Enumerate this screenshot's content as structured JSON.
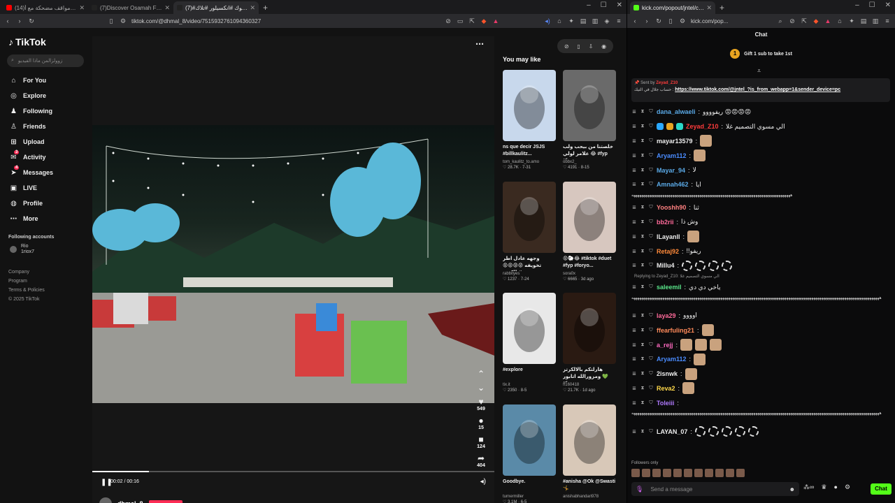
{
  "left_browser": {
    "tabs": [
      {
        "title": "(14)اليش أنا حولا؟ مواقف مضحكة مع أ",
        "fav_color": "#ff0000"
      },
      {
        "title": "(7)Discover Osamah Fayez: Best Mo",
        "fav_color": "#222222"
      },
      {
        "title": "(7)#تيك_توك #انكسيلور #تلاك...",
        "fav_color": "#222222"
      }
    ],
    "url": "tiktok.com/@dhmal_8/video/7515932761094360327"
  },
  "right_browser": {
    "tabs": [
      {
        "title": "kick.com/popout/jntel/chat",
        "fav_color": "#53fc18"
      }
    ],
    "url": "kick.com/pop..."
  },
  "tiktok": {
    "logo": "TikTok",
    "search_placeholder": "زوولزالمن ماذا الفيديو",
    "nav": [
      {
        "label": "For You",
        "icon": "home-icon"
      },
      {
        "label": "Explore",
        "icon": "compass-icon"
      },
      {
        "label": "Following",
        "icon": "following-icon"
      },
      {
        "label": "Friends",
        "icon": "friends-icon"
      },
      {
        "label": "Upload",
        "icon": "upload-icon"
      },
      {
        "label": "Activity",
        "icon": "activity-icon",
        "badge": "3"
      },
      {
        "label": "Messages",
        "icon": "messages-icon",
        "badge": "4"
      },
      {
        "label": "LIVE",
        "icon": "live-icon"
      },
      {
        "label": "Profile",
        "icon": "profile-icon"
      },
      {
        "label": "More",
        "icon": "more-icon"
      }
    ],
    "following_accounts_label": "Following accounts",
    "account": {
      "name": "Rio",
      "handle": "1riox7"
    },
    "footer": [
      "Company",
      "Program",
      "Terms & Policies",
      "© 2025 TikTok"
    ],
    "actions": {
      "likes": "549",
      "comments": "15",
      "saves": "124",
      "shares": "404"
    },
    "time": "00:02 / 00:16",
    "progress": 0.14,
    "author": "dhmal_8",
    "you_may_like": "You may like",
    "cards": [
      {
        "title": "ns que decir JSJS #billkaulitz...",
        "author": "tom_kaulitz_to.amo",
        "stats": "♡ 28.7K · 7-31",
        "bg": "#c8d8ec"
      },
      {
        "title": "خلصتنا من بيحب ولب علامر لولي 😂 #fyp #foryo...",
        "author": "obbx2_",
        "stats": "♡ 4191 · 8-15",
        "bg": "#6a6a6a"
      },
      {
        "title": "وجهه عادل اطر تخويفه 😡😡😡😡 #تالكرنز",
        "author": "rabbityes",
        "stats": "♡ 1237 · 7-24",
        "bg": "#3a2a20"
      },
      {
        "title": "😡🐑😂 #tiktok #duet #fyp #foryo...",
        "author": "sora0x",
        "stats": "♡ 6665 · 3d ago",
        "bg": "#d7c7bf"
      },
      {
        "title": "#explore",
        "author": "tix.it",
        "stats": "♡ 2350 · 8-5",
        "bg": "#e8e8e8"
      },
      {
        "title": "هارلتكم بالالكرتز ومزورالله اتابور 💚 #fyp...",
        "author": "ff160418",
        "stats": "♡ 21.7K · 1d ago",
        "bg": "#2a1a12"
      },
      {
        "title": "Goodbye.",
        "author": "turnermiller",
        "stats": "♡ 3.1M · 6-5",
        "bg": "#5a8aa8"
      },
      {
        "title": "#anisha @Ok @Swasti 🤸",
        "author": "anishabhandari978",
        "stats": "",
        "bg": "#d8c8b8"
      }
    ]
  },
  "kick": {
    "header": "Chat",
    "gift_count": "1",
    "gift_text": "Gift 1 sub to take 1st",
    "pinned": {
      "sent_by_label": "Sent by",
      "sender": "Zeyad_Z10",
      "text": "حساب جلال في التيك :",
      "link": "https://www.tiktok.com/@jntel_?is_from_webapp=1&sender_device=pc"
    },
    "messages": [
      {
        "user": "dana_alwaeli",
        "color": "#5aa9e6",
        "text": "ريفوووو 😡😡😡😡"
      },
      {
        "user": "Zeyad_Z10",
        "color": "#ff3b3b",
        "text": "الي مسوي التصميم غلا",
        "badges": true
      },
      {
        "user": "mayar13579",
        "color": "#eeeeee",
        "text": "",
        "emotes": 1
      },
      {
        "user": "Aryam112",
        "color": "#4a8cff",
        "text": "",
        "emotes": 1
      },
      {
        "user": "Mayar_94",
        "color": "#5aa9e6",
        "text": "لا"
      },
      {
        "user": "Amnah462",
        "color": "#5aa9e6",
        "text": "ايا"
      },
      {
        "spam": "ههههههههههههههههههههههههههههههههههههههههههههههههههههههههههههههههههههههههههههههههههه"
      },
      {
        "user": "Yooshh90",
        "color": "#ff8080",
        "text": "ثنا"
      },
      {
        "user": "bb2rii",
        "color": "#ff6a9a",
        "text": "وش ذا"
      },
      {
        "user": "lLayanll",
        "color": "#eeeeee",
        "text": "",
        "emotes": 1
      },
      {
        "user": "Retaj92",
        "color": "#ff8a3a",
        "text": "!!ريفو"
      },
      {
        "user": "Millu4",
        "color": "#eeeeee",
        "text": "",
        "wheels": 4
      },
      {
        "reply": "Replying to Zeyad_Z10: الي مسوي التصميم غلا"
      },
      {
        "user": "saleemil",
        "color": "#5ae68a",
        "text": "ياخي دي دي"
      },
      {
        "spam2": "ههههههههههههههههههههههههههههههههههههههههههههههههههههههههههههههههههههههههههههههههههههههههههههههههههههههههههههههههههههههههههههههههه"
      },
      {
        "user": "laya29",
        "color": "#ff6a9a",
        "text": "اوووو"
      },
      {
        "user": "ffearfuling21",
        "color": "#ff8a5a",
        "text": "",
        "emotes": 1
      },
      {
        "user": "a_rejj",
        "color": "#ff6ac0",
        "text": "",
        "emotes": 3
      },
      {
        "user": "Aryam112",
        "color": "#4a8cff",
        "text": "",
        "emotes": 1
      },
      {
        "user": "2isnwk",
        "color": "#eeeeee",
        "text": "",
        "emotes": 1
      },
      {
        "user": "Reva2",
        "color": "#ffd84a",
        "text": "",
        "emotes": 1
      },
      {
        "user": "Toleiii",
        "color": "#b07aff",
        "text": ""
      },
      {
        "spam2": "ههههههههههههههههههههههههههههههههههههههههههههههههههههههههههههههههههههههههههههههههههههههههههههههههههههههههههههههههههههههههههههههههه"
      },
      {
        "user": "LAYAN_07",
        "color": "#eeeeee",
        "text": "",
        "wheels": 5
      }
    ],
    "followers_only": "Followers only",
    "input_placeholder": "Send a message",
    "chat_button": "Chat"
  }
}
